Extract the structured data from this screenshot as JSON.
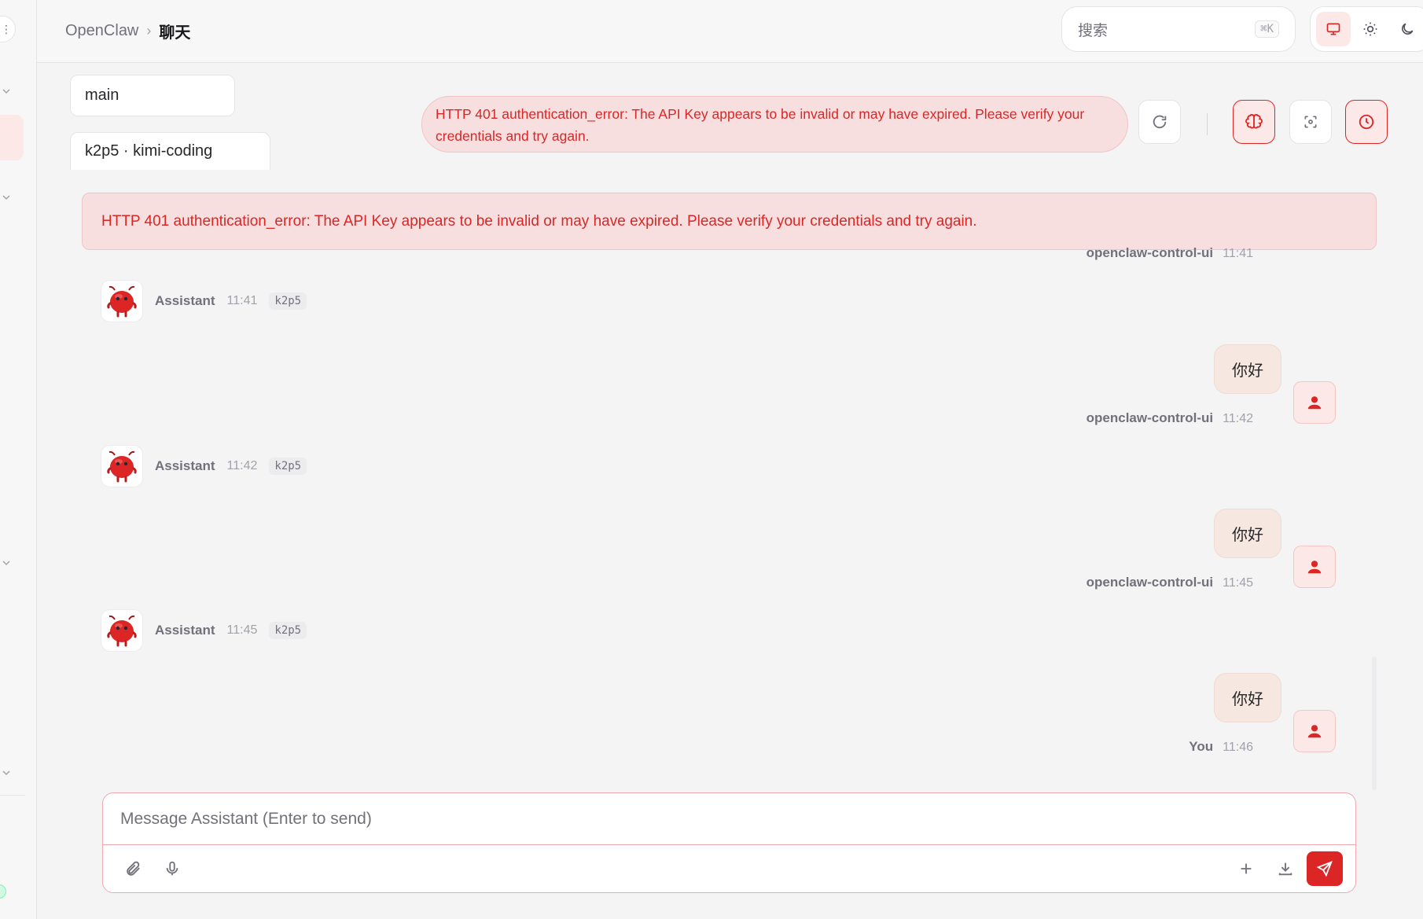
{
  "breadcrumb": {
    "root": "OpenClaw",
    "separator": "›",
    "current": "聊天"
  },
  "search": {
    "placeholder": "搜索",
    "shortcut": "⌘K"
  },
  "selectors": {
    "session": "main",
    "model": "k2p5 · kimi-coding"
  },
  "errors": {
    "top": "HTTP 401 authentication_error: The API Key appears to be invalid or may have expired. Please verify your credentials and try again.",
    "banner": "HTTP 401 authentication_error: The API Key appears to be invalid or may have expired. Please verify your credentials and try again."
  },
  "messages": [
    {
      "role": "user_partial",
      "name": "openclaw-control-ui",
      "time": "11:41"
    },
    {
      "role": "assistant",
      "name": "Assistant",
      "time": "11:41",
      "model": "k2p5"
    },
    {
      "role": "user",
      "text": "你好",
      "name": "openclaw-control-ui",
      "time": "11:42"
    },
    {
      "role": "assistant",
      "name": "Assistant",
      "time": "11:42",
      "model": "k2p5"
    },
    {
      "role": "user",
      "text": "你好",
      "name": "openclaw-control-ui",
      "time": "11:45"
    },
    {
      "role": "assistant",
      "name": "Assistant",
      "time": "11:45",
      "model": "k2p5"
    },
    {
      "role": "user",
      "text": "你好",
      "name": "You",
      "time": "11:46"
    }
  ],
  "composer": {
    "placeholder": "Message Assistant (Enter to send)"
  },
  "colors": {
    "accent": "#dc2626",
    "error_bg": "#f7dfe0",
    "user_bubble": "#f6e8e1"
  },
  "icons": {
    "theme": [
      "monitor-icon",
      "sun-icon",
      "moon-icon"
    ],
    "tools": [
      "refresh-icon",
      "brain-icon",
      "focus-icon",
      "clock-icon"
    ],
    "composer": [
      "paperclip-icon",
      "mic-icon",
      "plus-icon",
      "download-icon",
      "send-icon"
    ]
  }
}
